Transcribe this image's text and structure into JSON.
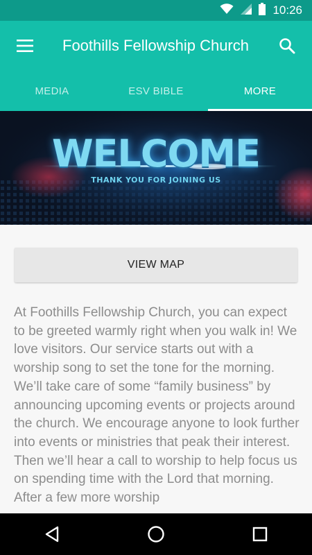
{
  "status_bar": {
    "time": "10:26",
    "icons": [
      "wifi-icon",
      "cellular-signal-icon",
      "battery-icon"
    ]
  },
  "toolbar": {
    "menu_icon": "hamburger-menu-icon",
    "title": "Foothills Fellowship Church",
    "search_icon": "search-icon",
    "color": "#14bfaa"
  },
  "tabs": [
    {
      "label": "MEDIA",
      "active": false
    },
    {
      "label": "ESV BIBLE",
      "active": false
    },
    {
      "label": "MORE",
      "active": true
    }
  ],
  "banner": {
    "title": "WELCOME",
    "subtitle": "THANK YOU FOR JOINING US"
  },
  "content": {
    "map_button_label": "VIEW MAP",
    "body_text": "At Foothills Fellowship Church, you can expect to be greeted warmly right when you walk in! We love visitors. Our service starts out with a worship song to set the tone for the morning. We’ll take care of some “family business” by announcing upcoming events or projects around the church. We encourage anyone to look further into events or ministries that peak their interest. Then we’ll hear a call to worship to help focus us on spending time with the Lord that morning. After a few more worship"
  },
  "nav_bar": {
    "buttons": [
      "back-icon",
      "home-icon",
      "recents-icon"
    ]
  },
  "colors": {
    "status_bar": "#0d9a8a",
    "accent": "#14bfaa",
    "body_text": "#8c8c8c"
  }
}
